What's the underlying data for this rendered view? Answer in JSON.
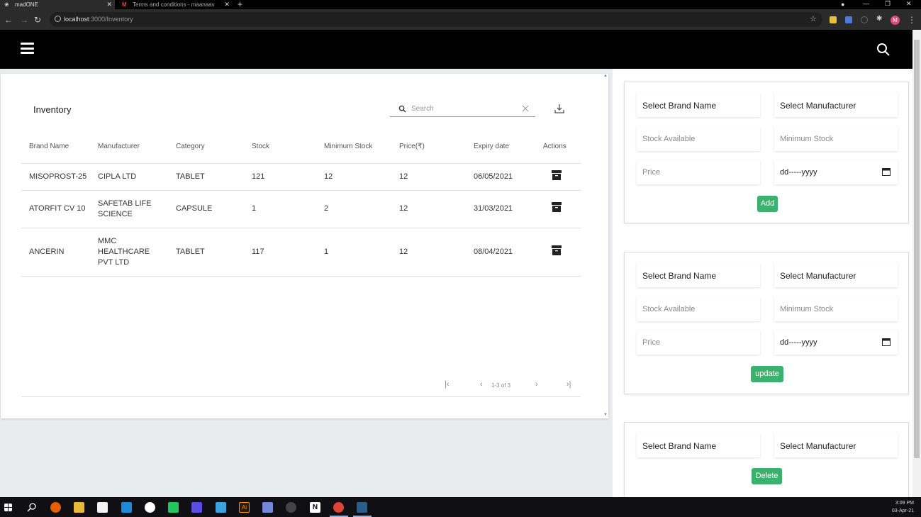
{
  "browser": {
    "tabs": [
      {
        "title": "madONE",
        "active": true
      },
      {
        "title": "Terms and conditions - maanaav",
        "active": false
      }
    ],
    "url_host": "localhost",
    "url_path": ":3000/Inventory",
    "profile_initial": "M"
  },
  "header": {
    "menu_icon": "hamburger-menu-icon",
    "search_icon": "search-icon"
  },
  "inventory": {
    "title": "Inventory",
    "search_placeholder": "Search",
    "columns": [
      "Brand Name",
      "Manufacturer",
      "Category",
      "Stock",
      "Minimum Stock",
      "Price(₹)",
      "Expiry date",
      "Actions"
    ],
    "rows": [
      {
        "brand": "MISOPROST-25",
        "manufacturer": "CIPLA LTD",
        "category": "TABLET",
        "stock": "121",
        "min_stock": "12",
        "price": "12",
        "expiry": "06/05/2021"
      },
      {
        "brand": "ATORFIT CV 10",
        "manufacturer": "SAFETAB LIFE SCIENCE",
        "category": "CAPSULE",
        "stock": "1",
        "min_stock": "2",
        "price": "12",
        "expiry": "31/03/2021"
      },
      {
        "brand": "ANCERIN",
        "manufacturer": "MMC HEALTHCARE PVT LTD",
        "category": "TABLET",
        "stock": "117",
        "min_stock": "1",
        "price": "12",
        "expiry": "08/04/2021"
      }
    ],
    "pagination": "1-3 of 3"
  },
  "forms": {
    "add": {
      "brand_ph": "Select Brand Name",
      "manufacturer_ph": "Select Manufacturer",
      "stock_ph": "Stock Available",
      "min_stock_ph": "Minimum Stock",
      "price_ph": "Price",
      "date_ph": "dd-----yyyy",
      "button": "Add"
    },
    "update": {
      "brand_ph": "Select Brand Name",
      "manufacturer_ph": "Select Manufacturer",
      "stock_ph": "Stock Available",
      "min_stock_ph": "Minimum Stock",
      "price_ph": "Price",
      "date_ph": "dd-----yyyy",
      "button": "update"
    },
    "delete": {
      "brand_ph": "Select Brand Name",
      "manufacturer_ph": "Select Manufacturer",
      "button": "Delete"
    }
  },
  "taskbar": {
    "time": "3:09 PM",
    "date": "03-Apr-21"
  },
  "colors": {
    "accent_green": "#3ab26e",
    "header_bg": "#000000",
    "page_bg": "#e9ecef"
  }
}
